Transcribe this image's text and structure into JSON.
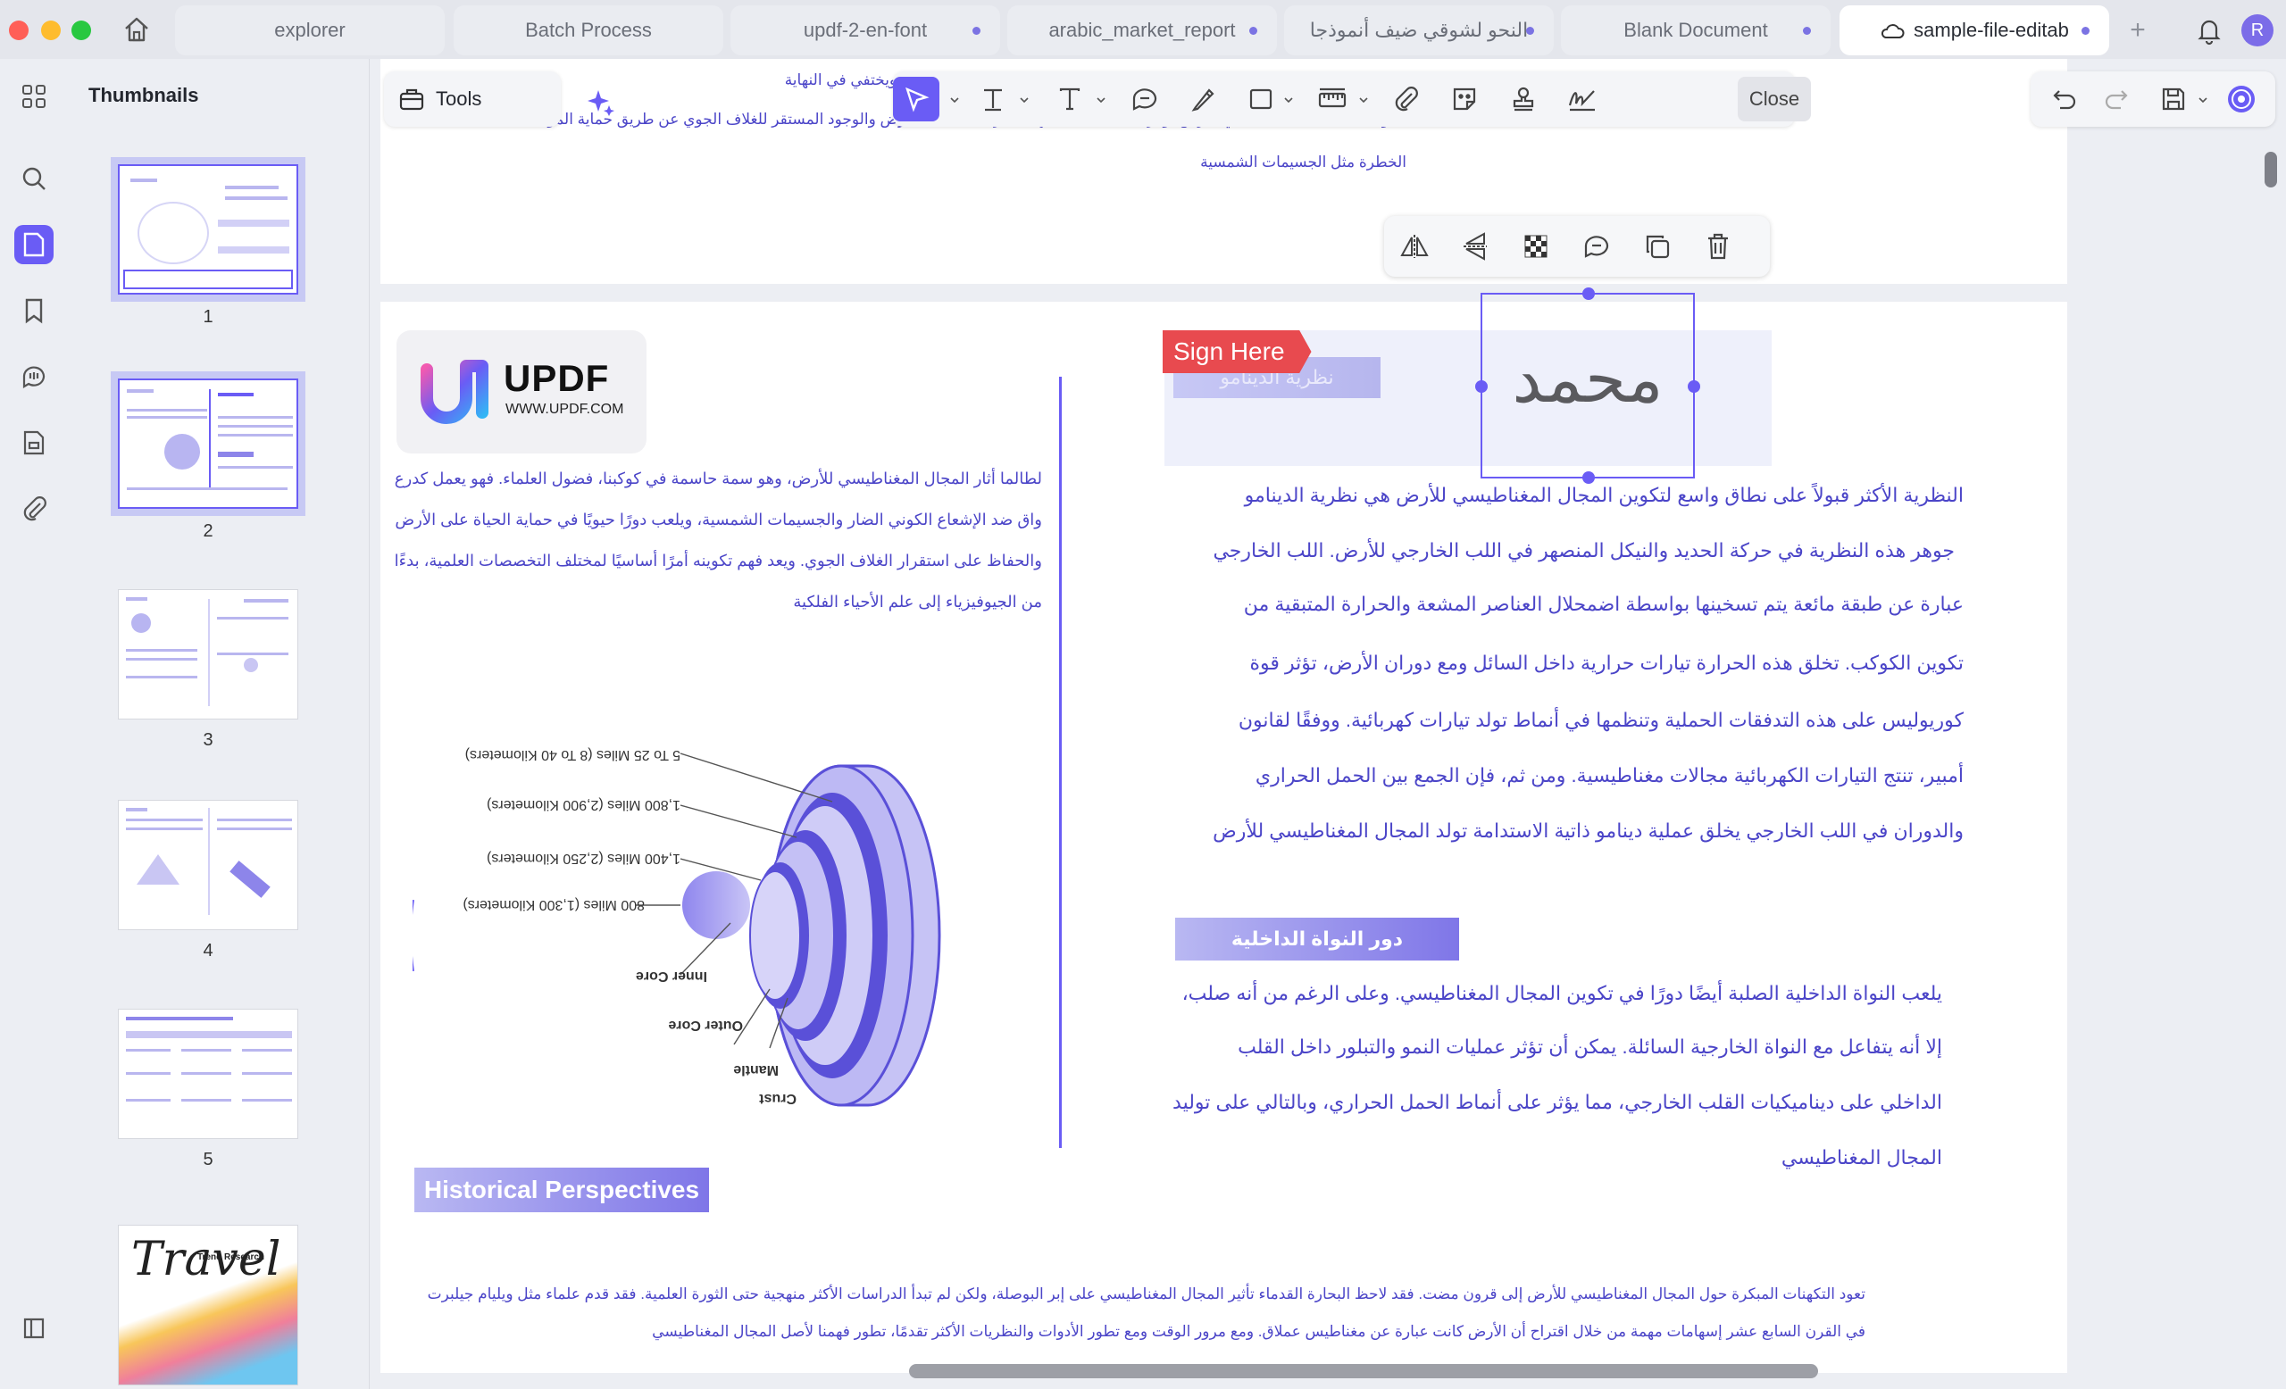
{
  "tabs": [
    {
      "label": "explorer",
      "dot": false
    },
    {
      "label": "Batch Process",
      "dot": false
    },
    {
      "label": "updf-2-en-font",
      "dot": true
    },
    {
      "label": "arabic_market_report",
      "dot": true
    },
    {
      "label": "النحو لشوقي ضيف أنموذجا",
      "dot": true
    },
    {
      "label": "Blank Document",
      "dot": true
    },
    {
      "label": "sample-file-editab",
      "dot": true,
      "active": true
    }
  ],
  "user_initial": "R",
  "thumbnails": {
    "title": "Thumbnails",
    "pages": [
      "1",
      "2",
      "3",
      "4",
      "5"
    ],
    "travel_preview": {
      "title": "Travel",
      "subtitle": "Trend Research"
    }
  },
  "toolbar": {
    "tools_label": "Tools",
    "close_label": "Close"
  },
  "page_a": {
    "line1": "جيًا يفعل قوى مثل الرياح الشمسية، ويختفي في النهاية",
    "line2": "القول أن المجال المغناطيسي للأرض يوفر ضمانة لا غنى عنها لتكاثر الحياة على الأرض والوجود المستقر للغلاف الجوي عن طريق حماية المواد",
    "line3": "الخطرة مثل الجسيمات الشمسية"
  },
  "page_b": {
    "logo_text": "UPDF",
    "logo_url": "WWW.UPDF.COM",
    "sign_tag": "Sign Here",
    "dynamo_heading": "نظرية الدينامو",
    "signature": "محمد",
    "intro": [
      "لطالما أثار المجال المغناطيسي للأرض، وهو سمة حاسمة في كوكبنا، فضول العلماء. فهو يعمل كدرع",
      "واق ضد الإشعاع الكوني الضار والجسيمات الشمسية، ويلعب دورًا حيويًا في حماية الحياة على الأرض",
      "والحفاظ على استقرار الغلاف الجوي. ويعد فهم تكوينه أمرًا أساسيًا لمختلف التخصصات العلمية، بدءًا",
      "من الجيوفيزياء إلى علم الأحياء الفلكية"
    ],
    "dynamo_text": [
      "النظرية الأكثر قبولاً على نطاق واسع لتكوين المجال المغناطيسي للأرض هي نظرية الدينامو",
      "جوهر هذه النظرية في حركة الحديد والنيكل المنصهر في اللب الخارجي للأرض. اللب الخارجي",
      "عبارة عن طبقة مائعة يتم تسخينها بواسطة اضمحلال العناصر المشعة والحرارة المتبقية من",
      "تكوين الكوكب. تخلق هذه الحرارة تيارات حرارية داخل السائل ومع دوران الأرض، تؤثر قوة",
      "كوريوليس على هذه التدفقات الحملية وتنظمها في أنماط تولد تيارات كهربائية. ووفقًا لقانون",
      "أمبير، تنتج التيارات الكهربائية مجالات مغناطيسية. ومن ثم، فإن الجمع بين الحمل الحراري",
      "والدوران في اللب الخارجي يخلق عملية دينامو ذاتية الاستدامة تولد المجال المغناطيسي للأرض"
    ],
    "core_heading": "دور النواة الداخلية",
    "core_text": [
      "يلعب النواة الداخلية الصلبة أيضًا دورًا في تكوين المجال المغناطيسي. وعلى الرغم من أنه صلب،",
      "إلا أنه يتفاعل مع النواة الخارجية السائلة. يمكن أن تؤثر عمليات النمو والتبلور داخل القلب",
      "الداخلي على ديناميكيات القلب الخارجي، مما يؤثر على أنماط الحمل الحراري، وبالتالي على توليد",
      "المجال المغناطيسي"
    ],
    "history_heading": "Historical Perspectives",
    "history_text": [
      "تعود التكهنات المبكرة حول المجال المغناطيسي للأرض إلى قرون مضت. فقد لاحظ البحارة القدماء تأثير المجال المغناطيسي على إبر البوصلة، ولكن لم تبدأ الدراسات الأكثر منهجية حتى الثورة العلمية. فقد قدم علماء مثل ويليام جيلبرت",
      "في القرن السابع عشر إسهامات مهمة من خلال اقتراح أن الأرض كانت عبارة عن مغناطيس عملاق. ومع مرور الوقت ومع تطور الأدوات والنظريات الأكثر تقدمًا، تطور فهمنا لأصل المجال المغناطيسي"
    ],
    "earth_labels": {
      "l1": "5 To 25 Miles (8 To 40 Kilometers)",
      "l2": "1,800 Miles (2,900 Kilometers)",
      "l3": "1,400 Miles (2,250 Kilometers)",
      "l4": "800 Miles (1,300 Kilometers)",
      "inner": "Inner Core",
      "outer": "Outer Core",
      "mantle": "Mantle",
      "crust": "Crust"
    }
  },
  "colors": {
    "accent": "#6a5cf5",
    "text_purple": "#4b45c8",
    "sign_red": "#e84a4f"
  }
}
